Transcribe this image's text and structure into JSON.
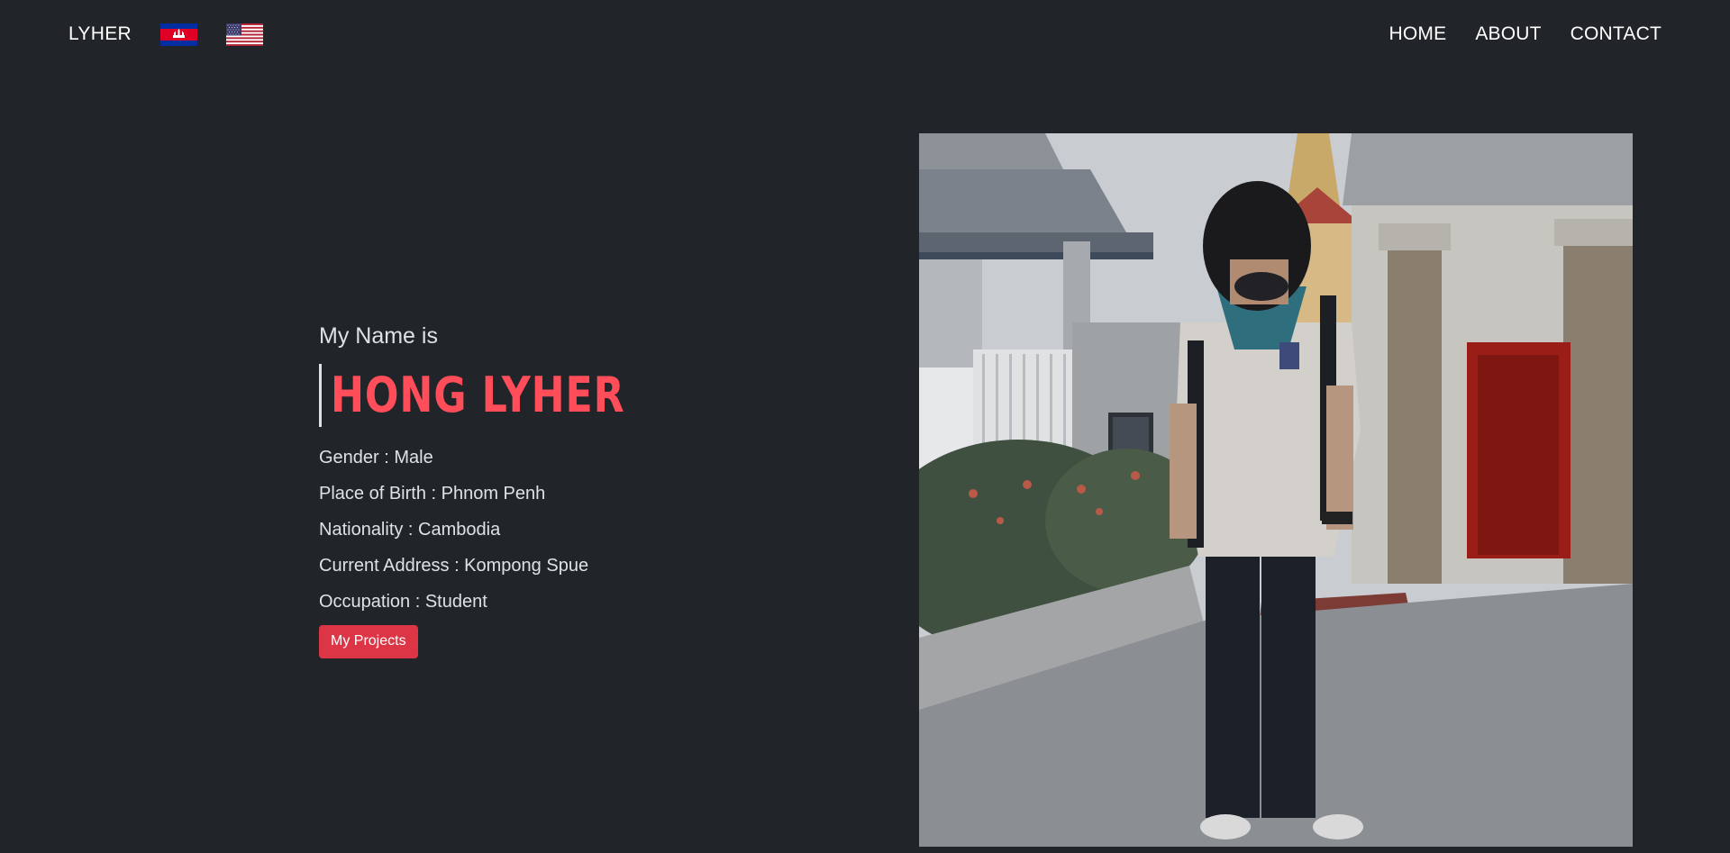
{
  "nav": {
    "brand": "LYHER",
    "links": [
      "HOME",
      "ABOUT",
      "CONTACT"
    ]
  },
  "flags": {
    "cambodia": "flag-cambodia-icon",
    "usa": "flag-usa-icon"
  },
  "intro": {
    "greeting": "My Name is",
    "name": "HONG LYHER",
    "details": [
      "Gender : Male",
      "Place of Birth : Phnom Penh",
      "Nationality : Cambodia",
      "Current Address : Kompong Spue",
      "Occupation : Student"
    ],
    "button_label": "My Projects"
  },
  "colors": {
    "background": "#212529",
    "accent_name": "#ff4d5a",
    "button": "#dc3545"
  }
}
